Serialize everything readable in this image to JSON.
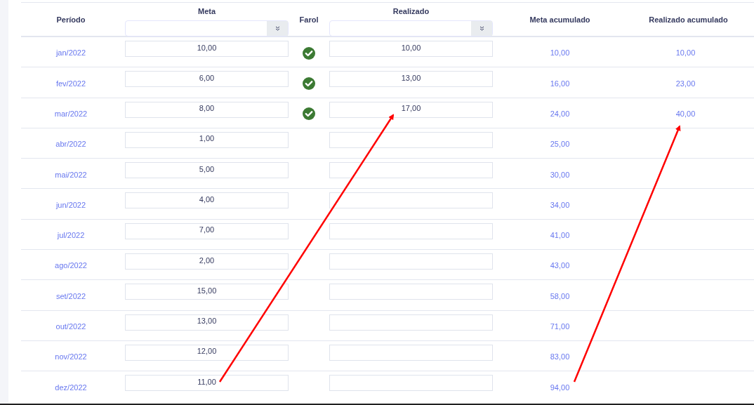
{
  "table": {
    "columns": [
      "Período",
      "Meta",
      "Farol",
      "Realizado",
      "Meta acumulado",
      "Realizado acumulado"
    ],
    "rows": [
      {
        "periodo": "jan/2022",
        "meta": "10,00",
        "farol_ok": true,
        "realizado": "10,00",
        "meta_acumulado": "10,00",
        "realizado_acumulado": "10,00"
      },
      {
        "periodo": "fev/2022",
        "meta": "6,00",
        "farol_ok": true,
        "realizado": "13,00",
        "meta_acumulado": "16,00",
        "realizado_acumulado": "23,00"
      },
      {
        "periodo": "mar/2022",
        "meta": "8,00",
        "farol_ok": true,
        "realizado": "17,00",
        "meta_acumulado": "24,00",
        "realizado_acumulado": "40,00"
      },
      {
        "periodo": "abr/2022",
        "meta": "1,00",
        "farol_ok": false,
        "meta_acumulado": "25,00"
      },
      {
        "periodo": "mai/2022",
        "meta": "5,00",
        "farol_ok": false,
        "meta_acumulado": "30,00"
      },
      {
        "periodo": "jun/2022",
        "meta": "4,00",
        "farol_ok": false,
        "meta_acumulado": "34,00"
      },
      {
        "periodo": "jul/2022",
        "meta": "7,00",
        "farol_ok": false,
        "meta_acumulado": "41,00"
      },
      {
        "periodo": "ago/2022",
        "meta": "2,00",
        "farol_ok": false,
        "meta_acumulado": "43,00"
      },
      {
        "periodo": "set/2022",
        "meta": "15,00",
        "farol_ok": false,
        "meta_acumulado": "58,00"
      },
      {
        "periodo": "out/2022",
        "meta": "13,00",
        "farol_ok": false,
        "meta_acumulado": "71,00"
      },
      {
        "periodo": "nov/2022",
        "meta": "12,00",
        "farol_ok": false,
        "meta_acumulado": "83,00"
      },
      {
        "periodo": "dez/2022",
        "meta": "11,00",
        "farol_ok": false,
        "meta_acumulado": "94,00"
      }
    ]
  }
}
